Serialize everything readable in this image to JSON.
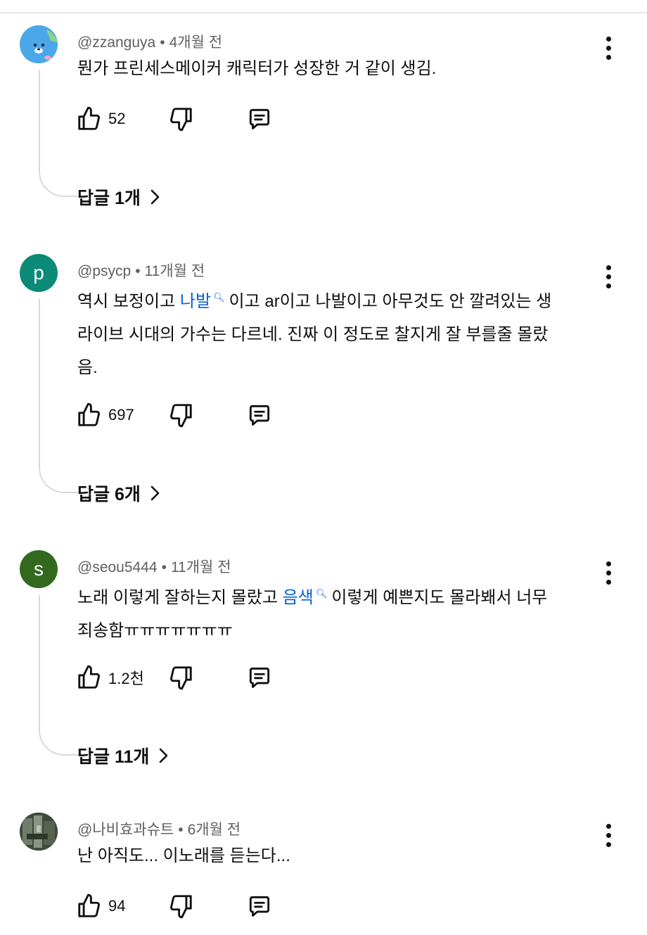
{
  "comments": [
    {
      "handle": "@zzanguya",
      "time": "4개월 전",
      "text_parts": [
        "뭔가 프린세스메이커 캐릭터가 성장한 거 같이 생김."
      ],
      "likes": "52",
      "replies_label": "답글 1개",
      "avatar_color": "#4aa8e8"
    },
    {
      "handle": "@psycp",
      "time": "11개월 전",
      "text_before": "역시 보정이고 ",
      "link": "나발",
      "text_after": "이고 ar이고 나발이고 아무것도 안 깔려있는 생",
      "text_line2": "라이브 시대의 가수는 다르네. 진짜 이 정도로 찰지게 잘 부를줄 몰랐",
      "text_line3": "음.",
      "avatar_letter": "p",
      "avatar_color": "#0b8a77",
      "likes": "697",
      "replies_label": "답글 6개"
    },
    {
      "handle": "@seou5444",
      "time": "11개월 전",
      "text_before": "노래 이렇게 잘하는지 몰랐고 ",
      "link": "음색",
      "text_after": "이렇게 예쁜지도 몰라봬서 너무",
      "text_line2": "죄송함ㅠㅠㅠㅠㅠㅠㅠ",
      "avatar_letter": "s",
      "avatar_color": "#33691e",
      "likes": "1.2천",
      "replies_label": "답글 11개"
    },
    {
      "handle": "@나비효과슈트",
      "time": "6개월 전",
      "text": "난 아직도... 이노래를 듣는다...",
      "likes": "94",
      "avatar_color": "#4a5a48"
    }
  ],
  "icons": {
    "like": "thumbs-up-icon",
    "dislike": "thumbs-down-icon",
    "reply": "reply-icon",
    "more": "more-vertical-icon",
    "search": "search-icon",
    "chevron": "chevron-right-icon"
  },
  "colors": {
    "link": "#065fd4",
    "meta": "#606060",
    "thread": "#d9d9d9"
  }
}
